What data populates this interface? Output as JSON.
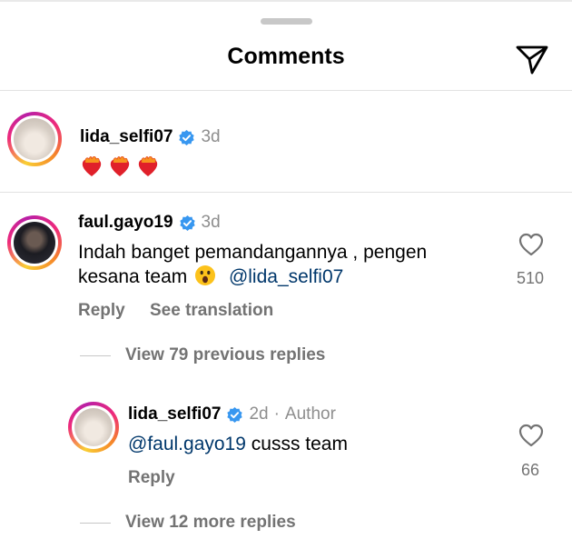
{
  "header": {
    "title": "Comments"
  },
  "comments": [
    {
      "username": "lida_selfi07",
      "time": "3d",
      "emoji_count": 3,
      "emoji_name": "heart-on-fire"
    },
    {
      "username": "faul.gayo19",
      "time": "3d",
      "text_line1": "Indah banget pemandangannya , pengen",
      "text_line2_prefix": "kesana team",
      "emoji_name": "astonished-face",
      "mention": "@lida_selfi07",
      "likes": "510",
      "reply_label": "Reply",
      "translate_label": "See translation",
      "view_previous": "View 79 previous replies"
    }
  ],
  "reply": {
    "username": "lida_selfi07",
    "time": "2d",
    "separator": "·",
    "author_tag": "Author",
    "mention": "@faul.gayo19",
    "text": "cusss team",
    "likes": "66",
    "reply_label": "Reply",
    "view_more": "View 12 more replies"
  },
  "colors": {
    "verified": "#3897f0",
    "mention": "#00376b",
    "muted": "#737373"
  }
}
